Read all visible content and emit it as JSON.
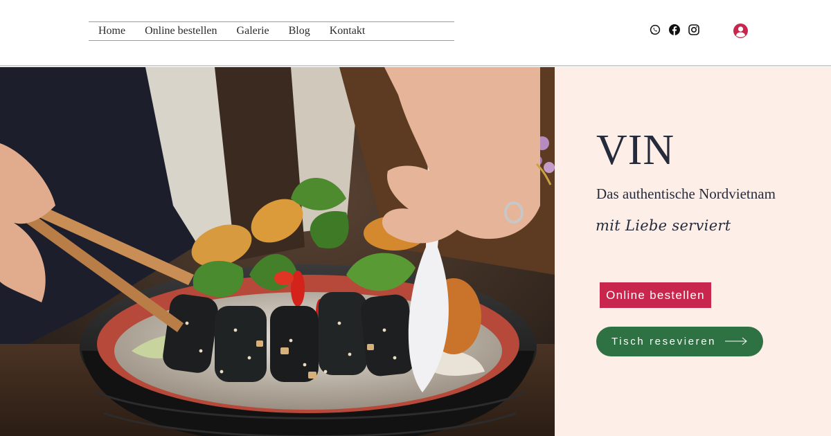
{
  "nav": {
    "items": [
      {
        "label": "Home"
      },
      {
        "label": "Online bestellen"
      },
      {
        "label": "Galerie"
      },
      {
        "label": "Blog"
      },
      {
        "label": "Kontakt"
      }
    ]
  },
  "social": {
    "icons": [
      "whatsapp-icon",
      "facebook-icon",
      "instagram-icon"
    ]
  },
  "login": {
    "icon": "user-avatar-icon",
    "color": "#c8264c"
  },
  "hero": {
    "image": "bowl-of-vietnamese-noodles-with-spring-rolls-and-herbs",
    "title": "VIN",
    "subtitle": "Das authentische Nordvietnam",
    "tagline": "mit Liebe serviert",
    "order_label": "Online bestellen",
    "reserve_label": "Tisch resevieren"
  },
  "colors": {
    "panel_bg": "#fdeee8",
    "accent_red": "#c8264c",
    "accent_green": "#2e7143",
    "text_dark": "#262b3b"
  }
}
